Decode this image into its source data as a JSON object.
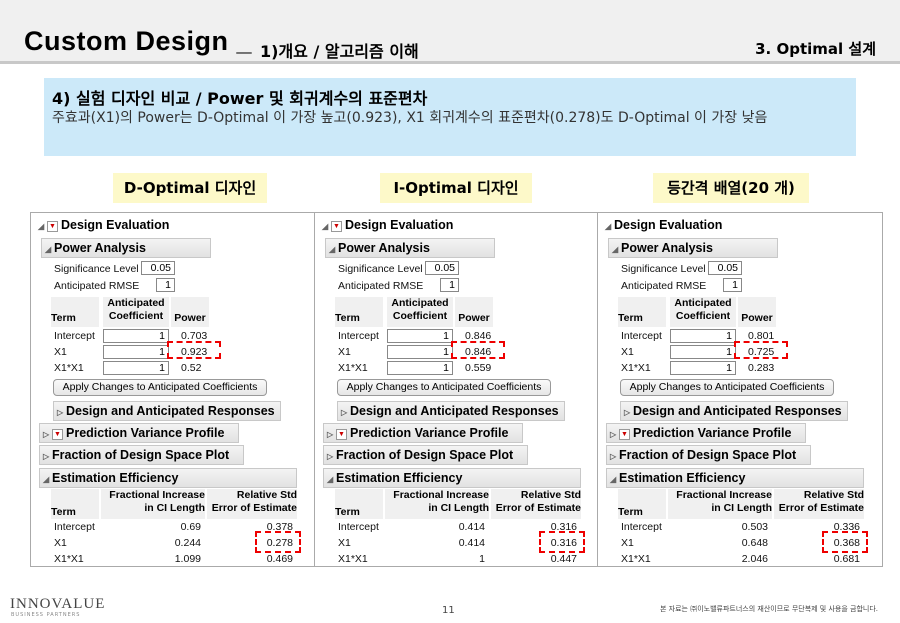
{
  "header": {
    "title": "Custom Design",
    "sep": "_",
    "subtitle": "1)개요 / 알고리즘 이해",
    "section": "3. Optimal 설계"
  },
  "summary": {
    "heading": "4) 실험 디자인 비교 / Power 및 회귀계수의 표준편차",
    "body": "주효과(X1)의 Power는 D-Optimal 이 가장 높고(0.923), X1 회귀계수의 표준편차(0.278)도 D-Optimal 이 가장 낮음"
  },
  "labels": [
    "D-Optimal 디자인",
    "I-Optimal 디자인",
    "등간격 배열(20 개)"
  ],
  "panel_text": {
    "design_evaluation": "Design Evaluation",
    "power_analysis": "Power Analysis",
    "significance_level": "Significance Level",
    "anticipated_rmse": "Anticipated RMSE",
    "col_term": "Term",
    "col_coef_1": "Anticipated",
    "col_coef_2": "Coefficient",
    "col_power": "Power",
    "apply_button": "Apply Changes to Anticipated Coefficients",
    "design_responses": "Design and Anticipated Responses",
    "pred_variance": "Prediction Variance Profile",
    "fds_plot": "Fraction of Design Space Plot",
    "estimation_efficiency": "Estimation Efficiency",
    "col_fi_1": "Fractional Increase",
    "col_fi_2": "in CI Length",
    "col_rse_1": "Relative Std",
    "col_rse_2": "Error of Estimate"
  },
  "panels": [
    {
      "name": "D-Optimal",
      "significance": "0.05",
      "rmse": "1",
      "power_rows": [
        {
          "term": "Intercept",
          "coef": "1",
          "power": "0.703"
        },
        {
          "term": "X1",
          "coef": "1",
          "power": "0.923"
        },
        {
          "term": "X1*X1",
          "coef": "1",
          "power": "0.52"
        }
      ],
      "eff_rows": [
        {
          "term": "Intercept",
          "fi": "0.69",
          "rse": "0.378"
        },
        {
          "term": "X1",
          "fi": "0.244",
          "rse": "0.278"
        },
        {
          "term": "X1*X1",
          "fi": "1.099",
          "rse": "0.469"
        }
      ]
    },
    {
      "name": "I-Optimal",
      "significance": "0.05",
      "rmse": "1",
      "power_rows": [
        {
          "term": "Intercept",
          "coef": "1",
          "power": "0.846"
        },
        {
          "term": "X1",
          "coef": "1",
          "power": "0.846"
        },
        {
          "term": "X1*X1",
          "coef": "1",
          "power": "0.559"
        }
      ],
      "eff_rows": [
        {
          "term": "Intercept",
          "fi": "0.414",
          "rse": "0.316"
        },
        {
          "term": "X1",
          "fi": "0.414",
          "rse": "0.316"
        },
        {
          "term": "X1*X1",
          "fi": "1",
          "rse": "0.447"
        }
      ]
    },
    {
      "name": "Equal-spacing",
      "significance": "0.05",
      "rmse": "1",
      "power_rows": [
        {
          "term": "Intercept",
          "coef": "1",
          "power": "0.801"
        },
        {
          "term": "X1",
          "coef": "1",
          "power": "0.725"
        },
        {
          "term": "X1*X1",
          "coef": "1",
          "power": "0.283"
        }
      ],
      "eff_rows": [
        {
          "term": "Intercept",
          "fi": "0.503",
          "rse": "0.336"
        },
        {
          "term": "X1",
          "fi": "0.648",
          "rse": "0.368"
        },
        {
          "term": "X1*X1",
          "fi": "2.046",
          "rse": "0.681"
        }
      ]
    }
  ],
  "footer": {
    "logo": "INNOVALUE",
    "logo_sub": "BUSINESS PARTNERS",
    "page": "11",
    "copyright": "본 자료는 ㈜이노밸류파트너스의 재산이므로 무단복제 및 사용을 금합니다."
  },
  "colors": {
    "highlight": "#e00000",
    "summary_bg": "#cce9f9",
    "label_bg": "#fdf9c9"
  }
}
